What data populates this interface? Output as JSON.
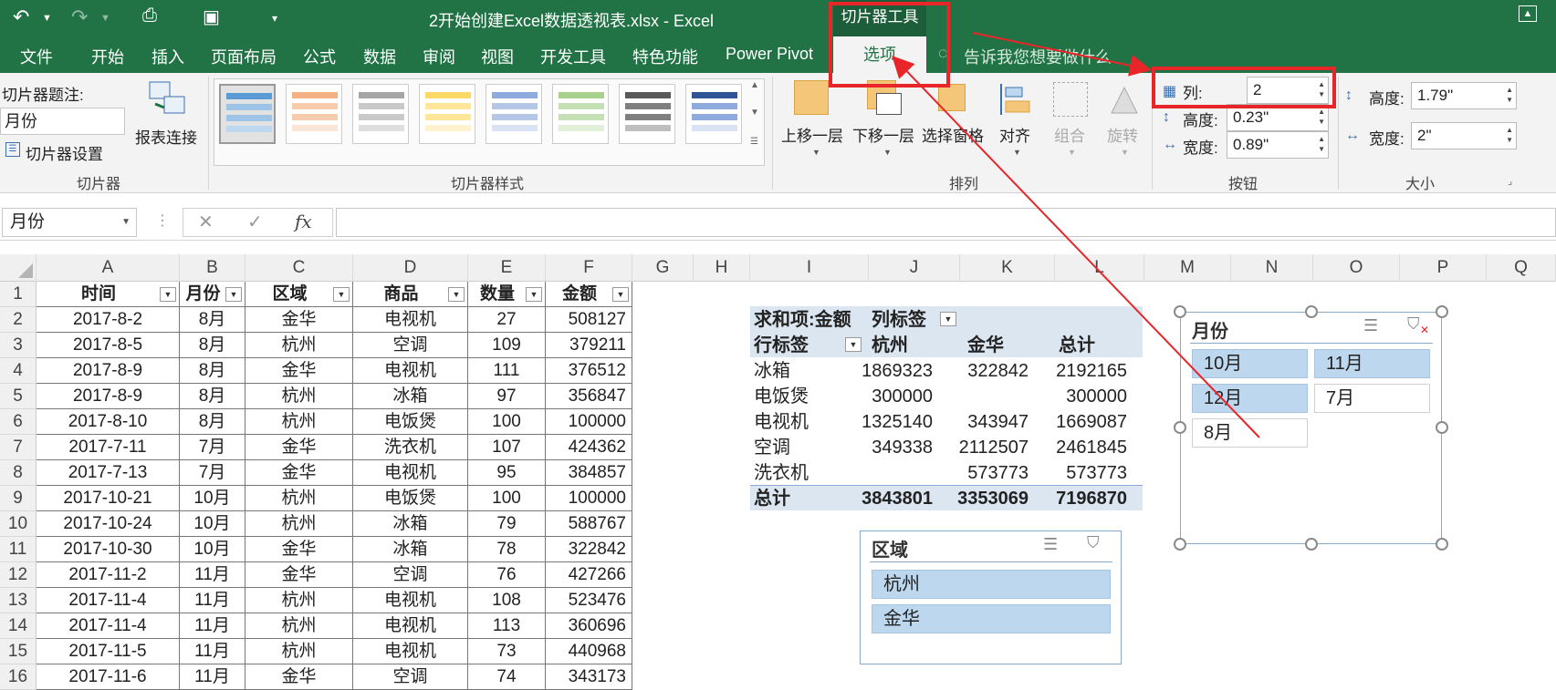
{
  "title": "2开始创建Excel数据透视表.xlsx - Excel",
  "contextual_tab": {
    "group_label": "切片器工具",
    "tab_label": "选项"
  },
  "menu": [
    "文件",
    "开始",
    "插入",
    "页面布局",
    "公式",
    "数据",
    "审阅",
    "视图",
    "开发工具",
    "特色功能",
    "Power Pivot"
  ],
  "tell_me": "告诉我您想要做什么",
  "ribbon": {
    "slicer_group": {
      "caption_label": "切片器题注:",
      "caption_value": "月份",
      "settings": "切片器设置",
      "report_conn": "报表连接",
      "group": "切片器"
    },
    "styles_group": {
      "group": "切片器样式"
    },
    "arrange_group": {
      "up": "上移一层",
      "down": "下移一层",
      "pane": "选择窗格",
      "align": "对齐",
      "group_btn": "组合",
      "rotate": "旋转",
      "group": "排列"
    },
    "buttons_group": {
      "columns_label": "列:",
      "columns_value": "2",
      "height_label": "高度:",
      "height_value": "0.23\"",
      "width_label": "宽度:",
      "width_value": "0.89\"",
      "group": "按钮"
    },
    "size_group": {
      "height_label": "高度:",
      "height_value": "1.79\"",
      "width_label": "宽度:",
      "width_value": "2\"",
      "group": "大小"
    }
  },
  "namebox": "月份",
  "columns": [
    "A",
    "B",
    "C",
    "D",
    "E",
    "F",
    "G",
    "H",
    "I",
    "J",
    "K",
    "L",
    "M",
    "N",
    "O",
    "P",
    "Q"
  ],
  "headers": [
    "时间",
    "月份",
    "区域",
    "商品",
    "数量",
    "金额"
  ],
  "rows": [
    [
      "2017-8-2",
      "8月",
      "金华",
      "电视机",
      "27",
      "508127"
    ],
    [
      "2017-8-5",
      "8月",
      "杭州",
      "空调",
      "109",
      "379211"
    ],
    [
      "2017-8-9",
      "8月",
      "金华",
      "电视机",
      "111",
      "376512"
    ],
    [
      "2017-8-9",
      "8月",
      "杭州",
      "冰箱",
      "97",
      "356847"
    ],
    [
      "2017-8-10",
      "8月",
      "杭州",
      "电饭煲",
      "100",
      "100000"
    ],
    [
      "2017-7-11",
      "7月",
      "金华",
      "洗衣机",
      "107",
      "424362"
    ],
    [
      "2017-7-13",
      "7月",
      "金华",
      "电视机",
      "95",
      "384857"
    ],
    [
      "2017-10-21",
      "10月",
      "杭州",
      "电饭煲",
      "100",
      "100000"
    ],
    [
      "2017-10-24",
      "10月",
      "杭州",
      "冰箱",
      "79",
      "588767"
    ],
    [
      "2017-10-30",
      "10月",
      "金华",
      "冰箱",
      "78",
      "322842"
    ],
    [
      "2017-11-2",
      "11月",
      "金华",
      "空调",
      "76",
      "427266"
    ],
    [
      "2017-11-4",
      "11月",
      "杭州",
      "电视机",
      "108",
      "523476"
    ],
    [
      "2017-11-4",
      "11月",
      "杭州",
      "电视机",
      "113",
      "360696"
    ],
    [
      "2017-11-5",
      "11月",
      "杭州",
      "电视机",
      "73",
      "440968"
    ],
    [
      "2017-11-6",
      "11月",
      "金华",
      "空调",
      "74",
      "343173"
    ]
  ],
  "pivot": {
    "header1": [
      "求和项:金额",
      "列标签"
    ],
    "header2": [
      "行标签",
      "杭州",
      "金华",
      "总计"
    ],
    "rows": [
      [
        "冰箱",
        "1869323",
        "322842",
        "2192165"
      ],
      [
        "电饭煲",
        "300000",
        "",
        "300000"
      ],
      [
        "电视机",
        "1325140",
        "343947",
        "1669087"
      ],
      [
        "空调",
        "349338",
        "2112507",
        "2461845"
      ],
      [
        "洗衣机",
        "",
        "573773",
        "573773"
      ]
    ],
    "total": [
      "总计",
      "3843801",
      "3353069",
      "7196870"
    ]
  },
  "slicer_month": {
    "title": "月份",
    "items": [
      "10月",
      "11月",
      "12月",
      "7月",
      "8月"
    ]
  },
  "slicer_region": {
    "title": "区域",
    "items": [
      "杭州",
      "金华"
    ]
  },
  "colors": {
    "excel_green": "#217346",
    "annotation_red": "#e8262a",
    "selected_item": "#bdd7ee",
    "pivot_header": "#dce6f1"
  }
}
